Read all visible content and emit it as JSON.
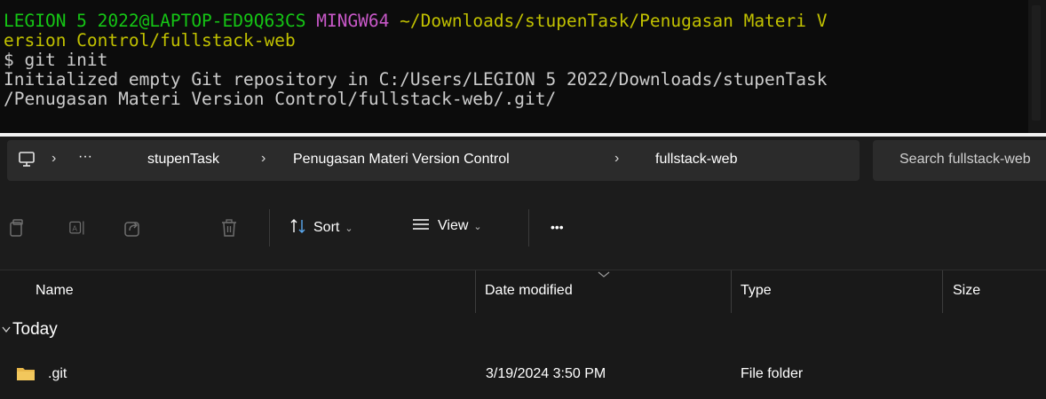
{
  "terminal": {
    "prompt_user": "LEGION 5 2022@LAPTOP-ED9Q63CS",
    "prompt_env": "MINGW64",
    "prompt_path_line1": "~/Downloads/stupenTask/Penugasan Materi V",
    "prompt_path_line2": "ersion Control/fullstack-web",
    "command": "$ git init",
    "output_line1": "Initialized empty Git repository in C:/Users/LEGION 5 2022/Downloads/stupenTask",
    "output_line2": "/Penugasan Materi Version Control/fullstack-web/.git/"
  },
  "address_bar": {
    "more": "···",
    "separator": "›",
    "crumbs": [
      "stupenTask",
      "Penugasan Materi Version Control",
      "fullstack-web"
    ],
    "search_placeholder": "Search fullstack-web"
  },
  "toolbar": {
    "sort_label": "Sort",
    "view_label": "View",
    "more": "•••",
    "icons": [
      "copy-icon",
      "rename-icon",
      "share-icon",
      "delete-icon"
    ]
  },
  "columns": {
    "name": "Name",
    "date_modified": "Date modified",
    "type": "Type",
    "size": "Size"
  },
  "group": {
    "label": "Today"
  },
  "files": [
    {
      "name": ".git",
      "date_modified": "3/19/2024 3:50 PM",
      "type": "File folder",
      "size": ""
    }
  ],
  "colors": {
    "terminal_bg": "#0c0c0c",
    "prompt_green": "#15c515",
    "prompt_magenta": "#c858c8",
    "prompt_yellow": "#c1c100",
    "explorer_bg": "#191919",
    "folder_yellow": "#e8b74a"
  }
}
